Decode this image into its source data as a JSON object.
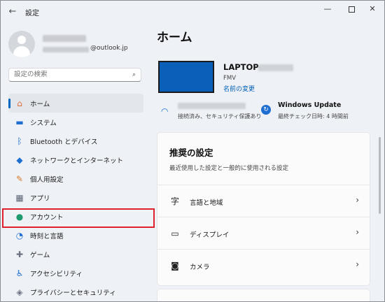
{
  "window": {
    "title": "設定",
    "back": "←",
    "minimize": "—",
    "close": "✕"
  },
  "user": {
    "email_suffix": "@outlook.jp"
  },
  "search": {
    "placeholder": "設定の検索",
    "icon": "search-icon"
  },
  "nav": {
    "items": [
      {
        "label": "ホーム",
        "icon": "home-icon",
        "glyph": "⌂",
        "color": "#e06b3a",
        "selected": true
      },
      {
        "label": "システム",
        "icon": "system-icon",
        "glyph": "▬",
        "color": "#1e6fd1"
      },
      {
        "label": "Bluetooth とデバイス",
        "icon": "bluetooth-icon",
        "glyph": "ᛒ",
        "color": "#1e6fd1"
      },
      {
        "label": "ネットワークとインターネット",
        "icon": "network-icon",
        "glyph": "◆",
        "color": "#1e6fd1"
      },
      {
        "label": "個人用設定",
        "icon": "personalization-icon",
        "glyph": "✎",
        "color": "#d97a2b"
      },
      {
        "label": "アプリ",
        "icon": "apps-icon",
        "glyph": "▦",
        "color": "#5b6675"
      },
      {
        "label": "アカウント",
        "icon": "account-icon",
        "glyph": "●",
        "color": "#1e9b6e"
      },
      {
        "label": "時刻と言語",
        "icon": "time-language-icon",
        "glyph": "◔",
        "color": "#1e6fd1"
      },
      {
        "label": "ゲーム",
        "icon": "gaming-icon",
        "glyph": "✚",
        "color": "#6b7380"
      },
      {
        "label": "アクセシビリティ",
        "icon": "accessibility-icon",
        "glyph": "♿",
        "color": "#1e6fd1"
      },
      {
        "label": "プライバシーとセキュリティ",
        "icon": "shield-icon",
        "glyph": "◈",
        "color": "#6b7380"
      }
    ]
  },
  "main": {
    "title": "ホーム",
    "device": {
      "name": "LAPTOP-",
      "model": "FMV",
      "rename": "名前の変更"
    },
    "network": {
      "status": "接続済み、セキュリティ保護あり"
    },
    "windows_update": {
      "title": "Windows Update",
      "status": "最終チェック日時: 4 時間前"
    },
    "recommended": {
      "title": "推奨の設定",
      "subtitle": "最近使用した設定と一般的に使用される設定",
      "rows": [
        {
          "label": "言語と地域",
          "icon": "language-icon",
          "glyph": "字"
        },
        {
          "label": "ディスプレイ",
          "icon": "display-icon",
          "glyph": "▭"
        },
        {
          "label": "カメラ",
          "icon": "camera-icon",
          "glyph": "◙"
        }
      ]
    }
  },
  "colors": {
    "accent": "#0067c0",
    "highlight": "#e0212d",
    "device": "#0a5fb8"
  }
}
